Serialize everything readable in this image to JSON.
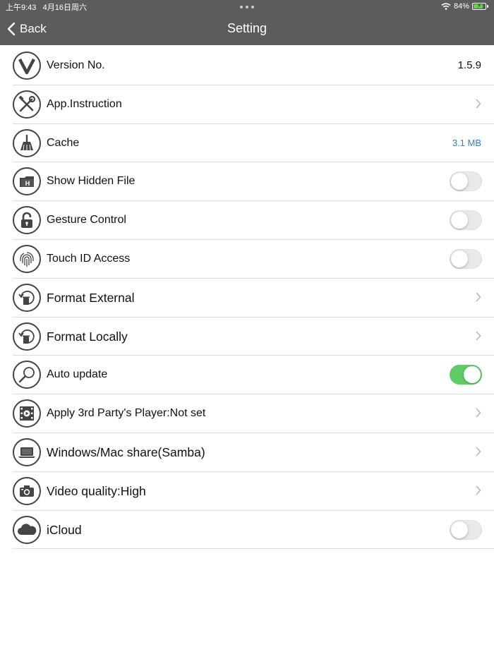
{
  "status_bar": {
    "time": "上午9:43",
    "date": "4月16日周六",
    "battery": "84%"
  },
  "nav": {
    "back_label": "Back",
    "title": "Setting"
  },
  "colors": {
    "header_bg": "#5c5c5c",
    "toggle_on": "#5fcb65",
    "value_blue": "#3b79c0"
  },
  "settings": [
    {
      "label": "Version No.",
      "icon": "version-v-icon",
      "value": "1.5.9"
    },
    {
      "label": "App.Instruction",
      "icon": "tools-icon",
      "accessory": "chevron"
    },
    {
      "label": "Cache",
      "icon": "broom-icon",
      "value": "3.1 MB"
    },
    {
      "label": "Show Hidden File",
      "icon": "hidden-folder-icon",
      "toggle": "off"
    },
    {
      "label": "Gesture Control",
      "icon": "lock-icon",
      "toggle": "off"
    },
    {
      "label": "Touch ID Access",
      "icon": "fingerprint-icon",
      "toggle": "off"
    },
    {
      "label": "Format External",
      "icon": "format-trash-icon",
      "accessory": "chevron"
    },
    {
      "label": "Format Locally",
      "icon": "format-trash-icon",
      "accessory": "chevron"
    },
    {
      "label": "Auto update",
      "icon": "magnifier-icon",
      "toggle": "on"
    },
    {
      "label": "Apply 3rd Party's Player:Not set",
      "icon": "film-player-icon",
      "accessory": "chevron"
    },
    {
      "label": "Windows/Mac share(Samba)",
      "icon": "laptop-icon",
      "accessory": "chevron"
    },
    {
      "label": "Video quality:High",
      "icon": "camera-icon",
      "accessory": "chevron"
    },
    {
      "label": "iCloud",
      "icon": "cloud-icon",
      "toggle": "off"
    }
  ]
}
